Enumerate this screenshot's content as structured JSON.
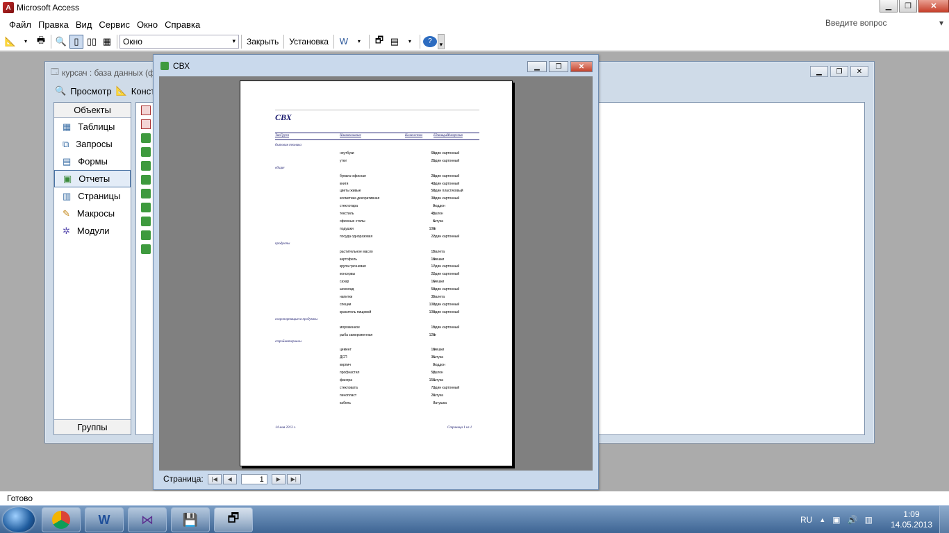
{
  "app": {
    "title": "Microsoft Access"
  },
  "menu": [
    "Файл",
    "Правка",
    "Вид",
    "Сервис",
    "Окно",
    "Справка"
  ],
  "help_box": {
    "placeholder": "Введите вопрос"
  },
  "toolbar": {
    "zoom_combo": "Окно",
    "close_label": "Закрыть",
    "setup_label": "Установка"
  },
  "dbwindow": {
    "title": "курсач : база данных (ф",
    "preview_label": "Просмотр",
    "design_label": "Констр",
    "objects_header": "Объекты",
    "objects": [
      "Таблицы",
      "Запросы",
      "Формы",
      "Отчеты",
      "Страницы",
      "Макросы",
      "Модули"
    ],
    "selected_object": "Отчеты",
    "groups_label": "Группы"
  },
  "report_window": {
    "title": "СВХ",
    "page_label": "Страница:",
    "page_number": "1"
  },
  "report": {
    "title": "СВХ",
    "columns": [
      "ТипГрупп",
      "Наименование",
      "Количество",
      "ЕдиницыИзмерения"
    ],
    "groups": [
      {
        "name": "бытовая техника",
        "rows": [
          {
            "name": "ноутбуки",
            "qty": "65",
            "unit": "один картонный"
          },
          {
            "name": "утюг",
            "qty": "25",
            "unit": "один картонный"
          }
        ]
      },
      {
        "name": "общие",
        "rows": [
          {
            "name": "бумага офисная",
            "qty": "20",
            "unit": "один картонный"
          },
          {
            "name": "книги",
            "qty": "43",
            "unit": "один картонный"
          },
          {
            "name": "цветы живые",
            "qty": "50",
            "unit": "один пластиковый"
          },
          {
            "name": "косметика декоративная",
            "qty": "30",
            "unit": "один картонный"
          },
          {
            "name": "стеклотара",
            "qty": "9",
            "unit": "поддон"
          },
          {
            "name": "текстиль",
            "qty": "45",
            "unit": "рулон"
          },
          {
            "name": "офисные столы",
            "qty": "6",
            "unit": "штука"
          },
          {
            "name": "подушки",
            "qty": "100",
            "unit": "кг"
          },
          {
            "name": "посуда одноразовая",
            "qty": "22",
            "unit": "один картонный"
          }
        ]
      },
      {
        "name": "продукты",
        "rows": [
          {
            "name": "растительное масло",
            "qty": "15",
            "unit": "палета"
          },
          {
            "name": "картофель",
            "qty": "10",
            "unit": "мешки"
          },
          {
            "name": "крупа гречневая",
            "qty": "17",
            "unit": "один картонный"
          },
          {
            "name": "консервы",
            "qty": "22",
            "unit": "один картонный"
          },
          {
            "name": "сахар",
            "qty": "16",
            "unit": "мешки"
          },
          {
            "name": "шоколад",
            "qty": "50",
            "unit": "один картонный"
          },
          {
            "name": "напитки",
            "qty": "35",
            "unit": "палета"
          },
          {
            "name": "специи",
            "qty": "100",
            "unit": "один картонный"
          },
          {
            "name": "краситель пищевой",
            "qty": "100",
            "unit": "один картонный"
          }
        ]
      },
      {
        "name": "скоропортящиеся продукты",
        "rows": [
          {
            "name": "мороженное",
            "qty": "15",
            "unit": "один картонный"
          },
          {
            "name": "рыба замороженная",
            "qty": "120",
            "unit": "кг"
          }
        ]
      },
      {
        "name": "стройматериалы",
        "rows": [
          {
            "name": "цемент",
            "qty": "10",
            "unit": "мешки"
          },
          {
            "name": "ДСП",
            "qty": "35",
            "unit": "штука"
          },
          {
            "name": "кирпич",
            "qty": "9",
            "unit": "поддон"
          },
          {
            "name": "профнастил",
            "qty": "50",
            "unit": "рулон"
          },
          {
            "name": "фанера",
            "qty": "150",
            "unit": "штука"
          },
          {
            "name": "стекловата",
            "qty": "73",
            "unit": "один картонный"
          },
          {
            "name": "пенопласт",
            "qty": "20",
            "unit": "штука"
          },
          {
            "name": "кабель",
            "qty": "7",
            "unit": "катушка"
          }
        ]
      }
    ],
    "footer_date": "14 мая 2013 г.",
    "footer_page": "Страница 1 из 1"
  },
  "statusbar": {
    "text": "Готово"
  },
  "tray": {
    "lang": "RU",
    "time": "1:09",
    "date": "14.05.2013"
  }
}
